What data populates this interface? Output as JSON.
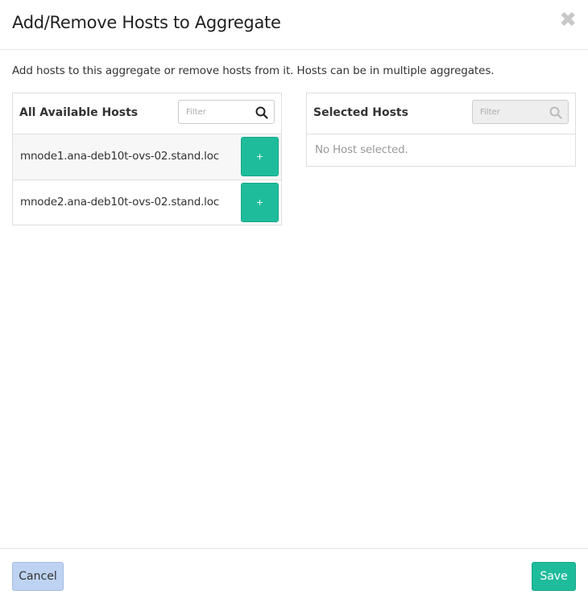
{
  "modal": {
    "title": "Add/Remove Hosts to Aggregate",
    "close_symbol": "✖",
    "intro": "Add hosts to this aggregate or remove hosts from it. Hosts can be in multiple aggregates."
  },
  "available": {
    "title": "All Available Hosts",
    "filter_placeholder": "Filter",
    "hosts": [
      {
        "name": "mnode1.ana-deb10t-ovs-02.stand.loc",
        "button": "+"
      },
      {
        "name": "mnode2.ana-deb10t-ovs-02.stand.loc",
        "button": "+"
      }
    ]
  },
  "selected": {
    "title": "Selected Hosts",
    "filter_placeholder": "Filter",
    "empty_text": "No Host selected."
  },
  "footer": {
    "cancel_label": "Cancel",
    "save_label": "Save"
  },
  "colors": {
    "accent": "#1fbc9c",
    "cancel_bg": "#bed3f2"
  }
}
